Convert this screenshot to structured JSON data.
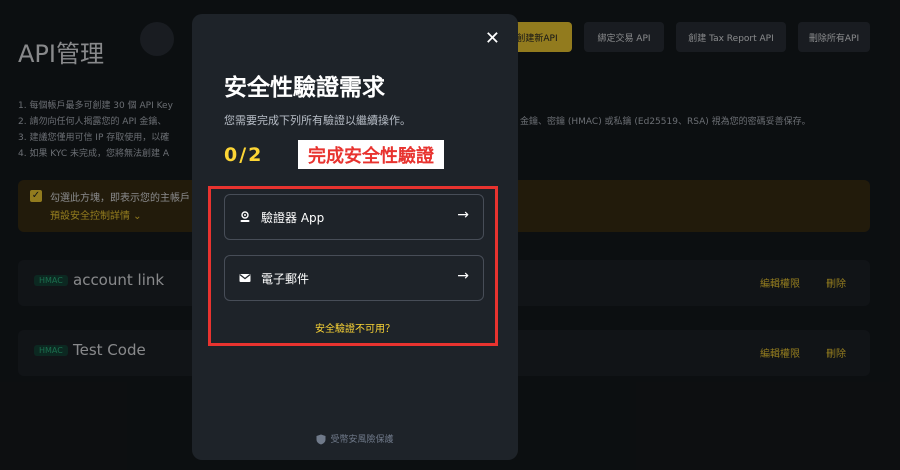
{
  "page": {
    "title": "API管理"
  },
  "toolbar": {
    "create_api": "創建新API",
    "link_trade_api": "綁定交易 API",
    "create_tax_api": "創建 Tax Report API",
    "delete_all": "刪除所有API"
  },
  "rules": [
    "1. 每個帳戶最多可創建 30 個 API Key",
    "2. 請勿向任何人揭露您的 API 金鑰、",
    "3. 建議您僅用可信 IP 存取使用，以確",
    "4. 如果 KYC 未完成，您將無法創建 A"
  ],
  "rules_right": "金鑰、密鑰 (HMAC) 或私鑰 (Ed25519、RSA) 視為您的密碼妥善保存。",
  "notice": {
    "line1": "勾選此方塊，即表示您的主帳戶",
    "line2": "預設安全控制詳情 ⌄"
  },
  "api_keys": [
    {
      "badge": "HMAC",
      "name": "account link",
      "edit": "編輯權限",
      "delete": "刪除"
    },
    {
      "badge": "HMAC",
      "name": "Test Code",
      "edit": "編輯權限",
      "delete": "刪除"
    }
  ],
  "modal": {
    "close_symbol": "✕",
    "title": "安全性驗證需求",
    "description": "您需要完成下列所有驗證以繼續操作。",
    "progress": "0/2",
    "annotation": "完成安全性驗證",
    "options": [
      {
        "label": "驗證器 App",
        "icon": "authenticator-icon"
      },
      {
        "label": "電子郵件",
        "icon": "email-icon"
      }
    ],
    "arrow": "→",
    "unavailable_link": "安全驗證不可用？",
    "footer": "受幣安風險保護"
  }
}
